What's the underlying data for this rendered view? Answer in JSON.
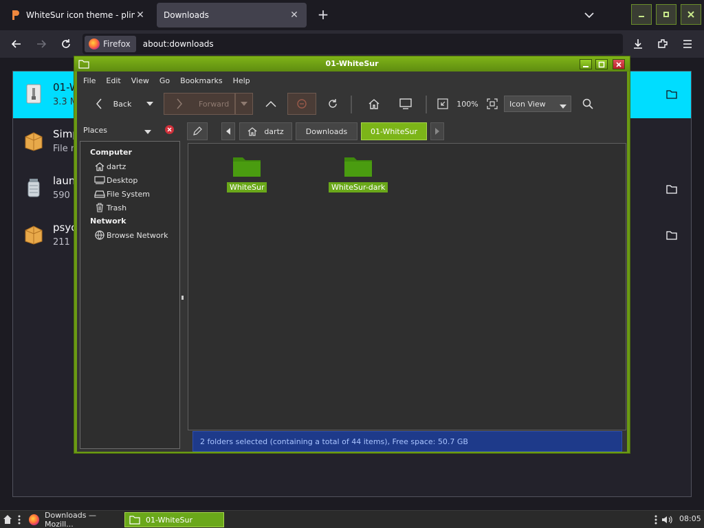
{
  "browser": {
    "tabs": [
      {
        "title": "WhiteSur icon theme - pling.com",
        "active": false
      },
      {
        "title": "Downloads",
        "active": true
      }
    ],
    "new_tab": "+",
    "identity_label": "Firefox",
    "url": "about:downloads"
  },
  "downloads": {
    "items": [
      {
        "name": "01-W",
        "status": "3.3 M",
        "selected": true
      },
      {
        "name": "Simp",
        "status": "File n",
        "selected": false
      },
      {
        "name": "laun",
        "status": "590 I",
        "selected": false
      },
      {
        "name": "psyc",
        "status": "211 M",
        "selected": false
      }
    ]
  },
  "file_manager": {
    "title": "01-WhiteSur",
    "menu": [
      "File",
      "Edit",
      "View",
      "Go",
      "Bookmarks",
      "Help"
    ],
    "toolbar": {
      "back_label": "Back",
      "forward_label": "Forward",
      "zoom": "100%",
      "view_mode": "Icon View"
    },
    "sidebar": {
      "header": "Places",
      "sections": [
        {
          "title": "Computer",
          "items": [
            "dartz",
            "Desktop",
            "File System",
            "Trash"
          ]
        },
        {
          "title": "Network",
          "items": [
            "Browse Network"
          ]
        }
      ]
    },
    "pathbar": [
      "dartz",
      "Downloads",
      "01-WhiteSur"
    ],
    "folders": [
      "WhiteSur",
      "WhiteSur-dark"
    ],
    "status": "2 folders selected (containing a total of 44 items), Free space: 50.7 GB"
  },
  "taskbar": {
    "tasks": [
      {
        "label": "Downloads — Mozill...",
        "active": false
      },
      {
        "label": "01-WhiteSur",
        "active": true
      }
    ],
    "clock": "08:05"
  },
  "colors": {
    "accent_green": "#6b9a14",
    "downloads_selected": "#00ddff",
    "status_blue": "#1e3a8a"
  }
}
